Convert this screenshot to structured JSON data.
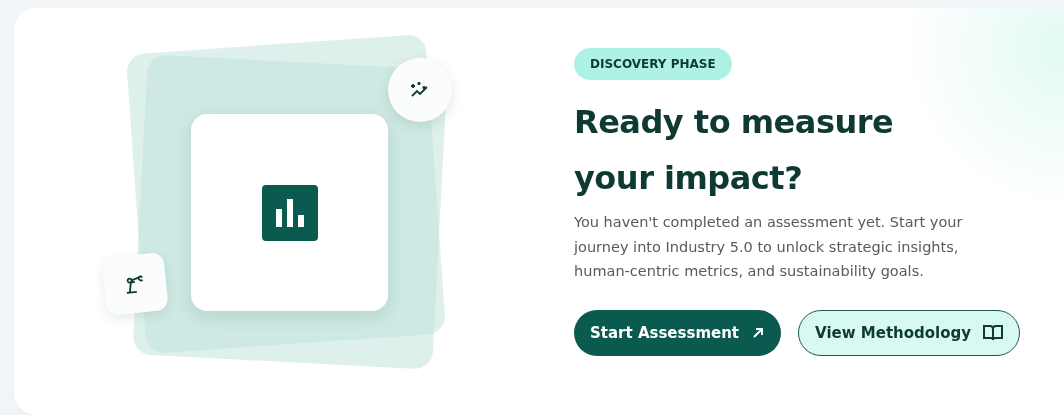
{
  "badge": "DISCOVERY PHASE",
  "heading": "Ready to measure your impact?",
  "description": "You haven't completed an assessment yet. Start your journey into Industry 5.0 to unlock strategic insights, human-centric metrics, and sustainability goals.",
  "buttons": [
    {
      "label": "Start Assessment",
      "kind": "primary"
    },
    {
      "label": "View Methodology",
      "kind": "outline"
    }
  ]
}
